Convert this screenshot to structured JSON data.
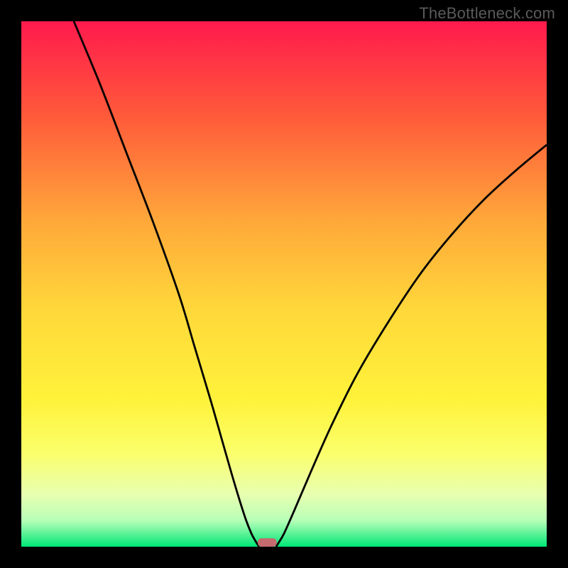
{
  "watermark": "TheBottleneck.com",
  "chart_data": {
    "type": "line",
    "title": "",
    "xlabel": "",
    "ylabel": "",
    "xlim": [
      0,
      100
    ],
    "ylim": [
      0,
      100
    ],
    "background_gradient": {
      "stops": [
        {
          "offset": 0.0,
          "color": "#ff1a4d"
        },
        {
          "offset": 0.18,
          "color": "#ff5a3a"
        },
        {
          "offset": 0.38,
          "color": "#ffa83a"
        },
        {
          "offset": 0.55,
          "color": "#ffd83a"
        },
        {
          "offset": 0.72,
          "color": "#fff23a"
        },
        {
          "offset": 0.82,
          "color": "#fbff6a"
        },
        {
          "offset": 0.9,
          "color": "#e8ffb0"
        },
        {
          "offset": 0.95,
          "color": "#b8ffb8"
        },
        {
          "offset": 1.0,
          "color": "#00e676"
        }
      ]
    },
    "series": [
      {
        "name": "left-curve",
        "x": [
          10.0,
          15.0,
          20.0,
          25.0,
          30.0,
          33.0,
          36.0,
          38.0,
          40.0,
          41.5,
          42.8,
          43.8,
          44.5,
          45.0,
          45.3
        ],
        "y": [
          100.0,
          88.0,
          75.0,
          62.0,
          48.0,
          38.0,
          28.0,
          21.0,
          14.0,
          9.0,
          5.0,
          2.5,
          1.2,
          0.4,
          0.0
        ]
      },
      {
        "name": "right-curve",
        "x": [
          48.5,
          49.0,
          50.0,
          52.0,
          55.0,
          59.0,
          64.0,
          70.0,
          76.0,
          82.0,
          88.0,
          94.0,
          100.0
        ],
        "y": [
          0.0,
          0.8,
          2.5,
          7.0,
          14.0,
          23.0,
          33.0,
          43.0,
          52.0,
          59.5,
          66.0,
          71.5,
          76.5
        ]
      }
    ],
    "marker": {
      "name": "bottom-marker",
      "x_center": 46.8,
      "width": 3.6,
      "height": 1.6,
      "y": 0.0,
      "color": "#c56a6e"
    },
    "grid": false,
    "legend": false
  }
}
